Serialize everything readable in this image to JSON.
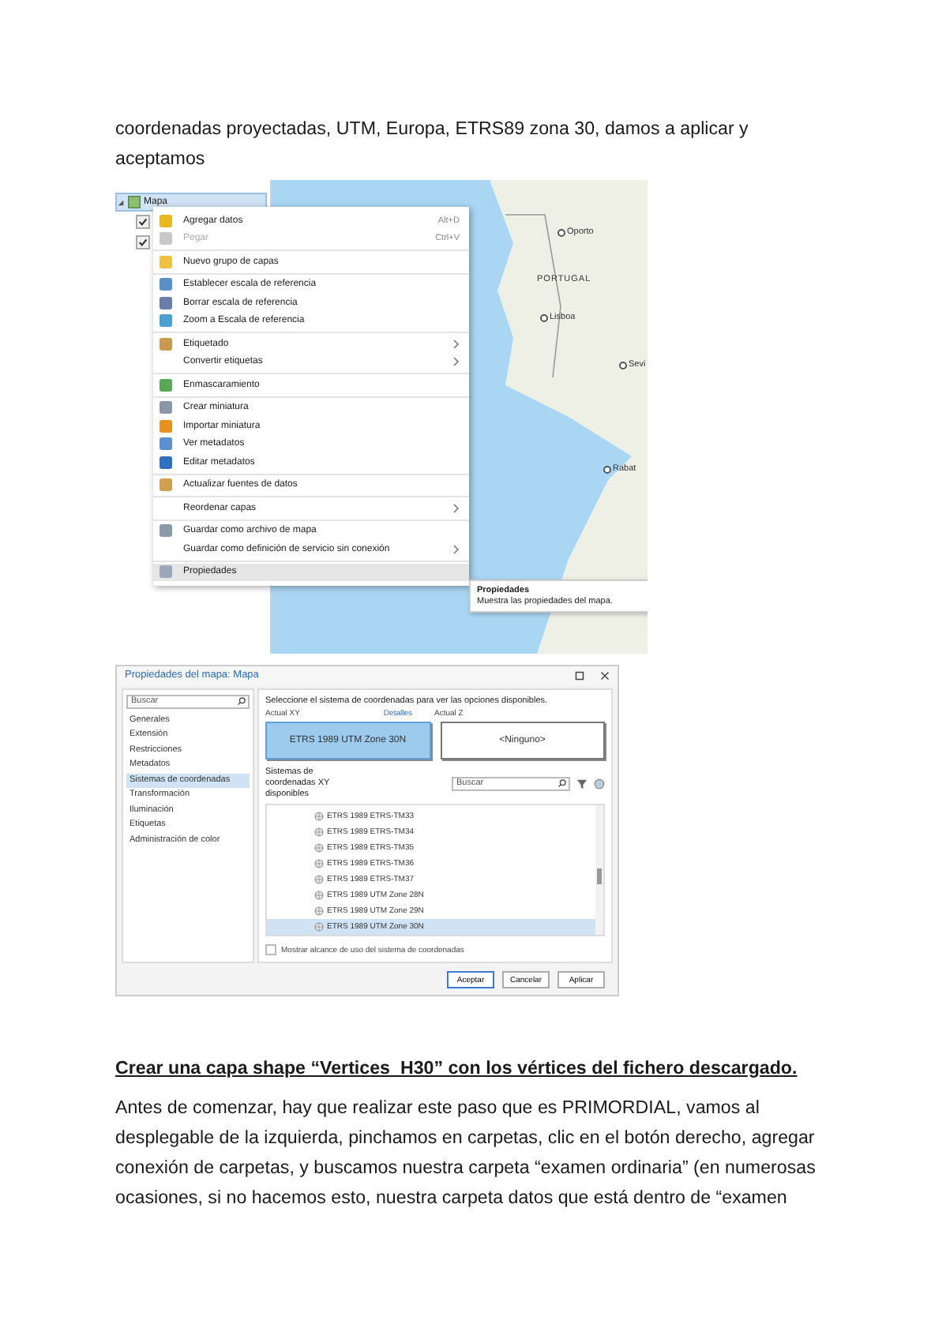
{
  "intro": "coordenadas proyectadas, UTM, Europa, ETRS89 zona 30, damos a aplicar y aceptamos",
  "screenshot_1": {
    "tree": {
      "root": "Mapa",
      "expanded": true,
      "layers": [
        {
          "checked": true
        },
        {
          "checked": true
        }
      ]
    },
    "map_labels": [
      {
        "text": "Oporto",
        "kind": "city"
      },
      {
        "text": "PORTUGAL",
        "kind": "country"
      },
      {
        "text": "Lisboa",
        "kind": "city"
      },
      {
        "text": "Sevi",
        "kind": "city"
      },
      {
        "text": "Rabat",
        "kind": "city"
      }
    ],
    "menu": [
      [
        {
          "label": "Agregar datos",
          "shortcut": "Alt+D",
          "color": "#e8b820",
          "disabled": false,
          "submenu": false,
          "selected": false
        },
        {
          "label": "Pegar",
          "shortcut": "Ctrl+V",
          "color": "#c8c8c8",
          "disabled": true,
          "submenu": false,
          "selected": false
        }
      ],
      [
        {
          "label": "Nuevo grupo de capas",
          "color": "#f0c040",
          "disabled": false,
          "submenu": false,
          "selected": false
        }
      ],
      [
        {
          "label": "Establecer escala de referencia",
          "color": "#5a8fc8",
          "disabled": false,
          "submenu": false,
          "selected": false
        },
        {
          "label": "Borrar escala de referencia",
          "color": "#6a7fa8",
          "disabled": false,
          "submenu": false,
          "selected": false
        },
        {
          "label": "Zoom a Escala de referencia",
          "color": "#4aa0d0",
          "disabled": false,
          "submenu": false,
          "selected": false
        }
      ],
      [
        {
          "label": "Etiquetado",
          "color": "#c89a50",
          "disabled": false,
          "submenu": true,
          "selected": false
        },
        {
          "label": "Convertir etiquetas",
          "disabled": false,
          "submenu": true,
          "selected": false
        }
      ],
      [
        {
          "label": "Enmascaramiento",
          "color": "#58a858",
          "disabled": false,
          "submenu": false,
          "selected": false
        }
      ],
      [
        {
          "label": "Crear miniatura",
          "color": "#8898a8",
          "disabled": false,
          "submenu": false,
          "selected": false
        },
        {
          "label": "Importar miniatura",
          "color": "#e89020",
          "disabled": false,
          "submenu": false,
          "selected": false
        },
        {
          "label": "Ver metadatos",
          "color": "#5a90d0",
          "disabled": false,
          "submenu": false,
          "selected": false
        },
        {
          "label": "Editar metadatos",
          "color": "#3070c0",
          "disabled": false,
          "submenu": false,
          "selected": false
        }
      ],
      [
        {
          "label": "Actualizar fuentes de datos",
          "color": "#d0a050",
          "disabled": false,
          "submenu": false,
          "selected": false
        }
      ],
      [
        {
          "label": "Reordenar capas",
          "disabled": false,
          "submenu": true,
          "selected": false
        }
      ],
      [
        {
          "label": "Guardar como archivo de mapa",
          "color": "#8a9aaa",
          "disabled": false,
          "submenu": false,
          "selected": false
        },
        {
          "label": "Guardar como definición de servicio sin conexión",
          "disabled": false,
          "submenu": true,
          "selected": false
        }
      ],
      [
        {
          "label": "Propiedades",
          "color": "#9aa8b8",
          "disabled": false,
          "submenu": false,
          "selected": true
        }
      ]
    ],
    "tooltip": {
      "title": "Propiedades",
      "text": "Muestra las propiedades del mapa."
    }
  },
  "screenshot_2": {
    "title": "Propiedades del mapa: Mapa",
    "search": {
      "placeholder": "Buscar"
    },
    "sidebar": [
      {
        "label": "Generales",
        "selected": false
      },
      {
        "label": "Extensión",
        "selected": false
      },
      {
        "label": "Restricciones",
        "selected": false
      },
      {
        "label": "Metadatos",
        "selected": false
      },
      {
        "label": "Sistemas de coordenadas",
        "selected": true
      },
      {
        "label": "Transformación",
        "selected": false
      },
      {
        "label": "Iluminación",
        "selected": false
      },
      {
        "label": "Etiquetas",
        "selected": false
      },
      {
        "label": "Administración de color",
        "selected": false
      }
    ],
    "instruction": "Seleccione el sistema de coordenadas para ver las opciones disponibles.",
    "current_xy_label": "Actual XY",
    "details_link": "Detalles",
    "current_z_label": "Actual Z",
    "current_choices": [
      {
        "label": "ETRS 1989 UTM Zone 30N",
        "selected": true
      },
      {
        "label": "<Ninguno>",
        "selected": false
      }
    ],
    "available_label": "Sistemas de coordenadas XY disponibles",
    "filter": {
      "placeholder": "Buscar"
    },
    "systems": [
      {
        "label": "ETRS 1989 ETRS-TM33",
        "selected": false
      },
      {
        "label": "ETRS 1989 ETRS-TM34",
        "selected": false
      },
      {
        "label": "ETRS 1989 ETRS-TM35",
        "selected": false
      },
      {
        "label": "ETRS 1989 ETRS-TM36",
        "selected": false
      },
      {
        "label": "ETRS 1989 ETRS-TM37",
        "selected": false
      },
      {
        "label": "ETRS 1989 UTM Zone 28N",
        "selected": false
      },
      {
        "label": "ETRS 1989 UTM Zone 29N",
        "selected": false
      },
      {
        "label": "ETRS 1989 UTM Zone 30N",
        "selected": true
      }
    ],
    "show_extent": {
      "label": "Mostrar alcance de uso del sistema de coordenadas",
      "checked": false
    },
    "buttons": [
      "Aceptar",
      "Cancelar",
      "Aplicar"
    ]
  },
  "heading": "Crear una capa shape “Vertices_H30” con los vértices del fichero descargado.",
  "paragraph": "Antes de comenzar, hay que realizar este paso que es PRIMORDIAL, vamos al desplegable de la izquierda, pinchamos en carpetas, clic en el botón derecho, agregar conexión de carpetas, y buscamos nuestra carpeta “examen ordinaria” (en numerosas ocasiones, si no hacemos esto, nuestra carpeta datos que está dentro de “examen"
}
